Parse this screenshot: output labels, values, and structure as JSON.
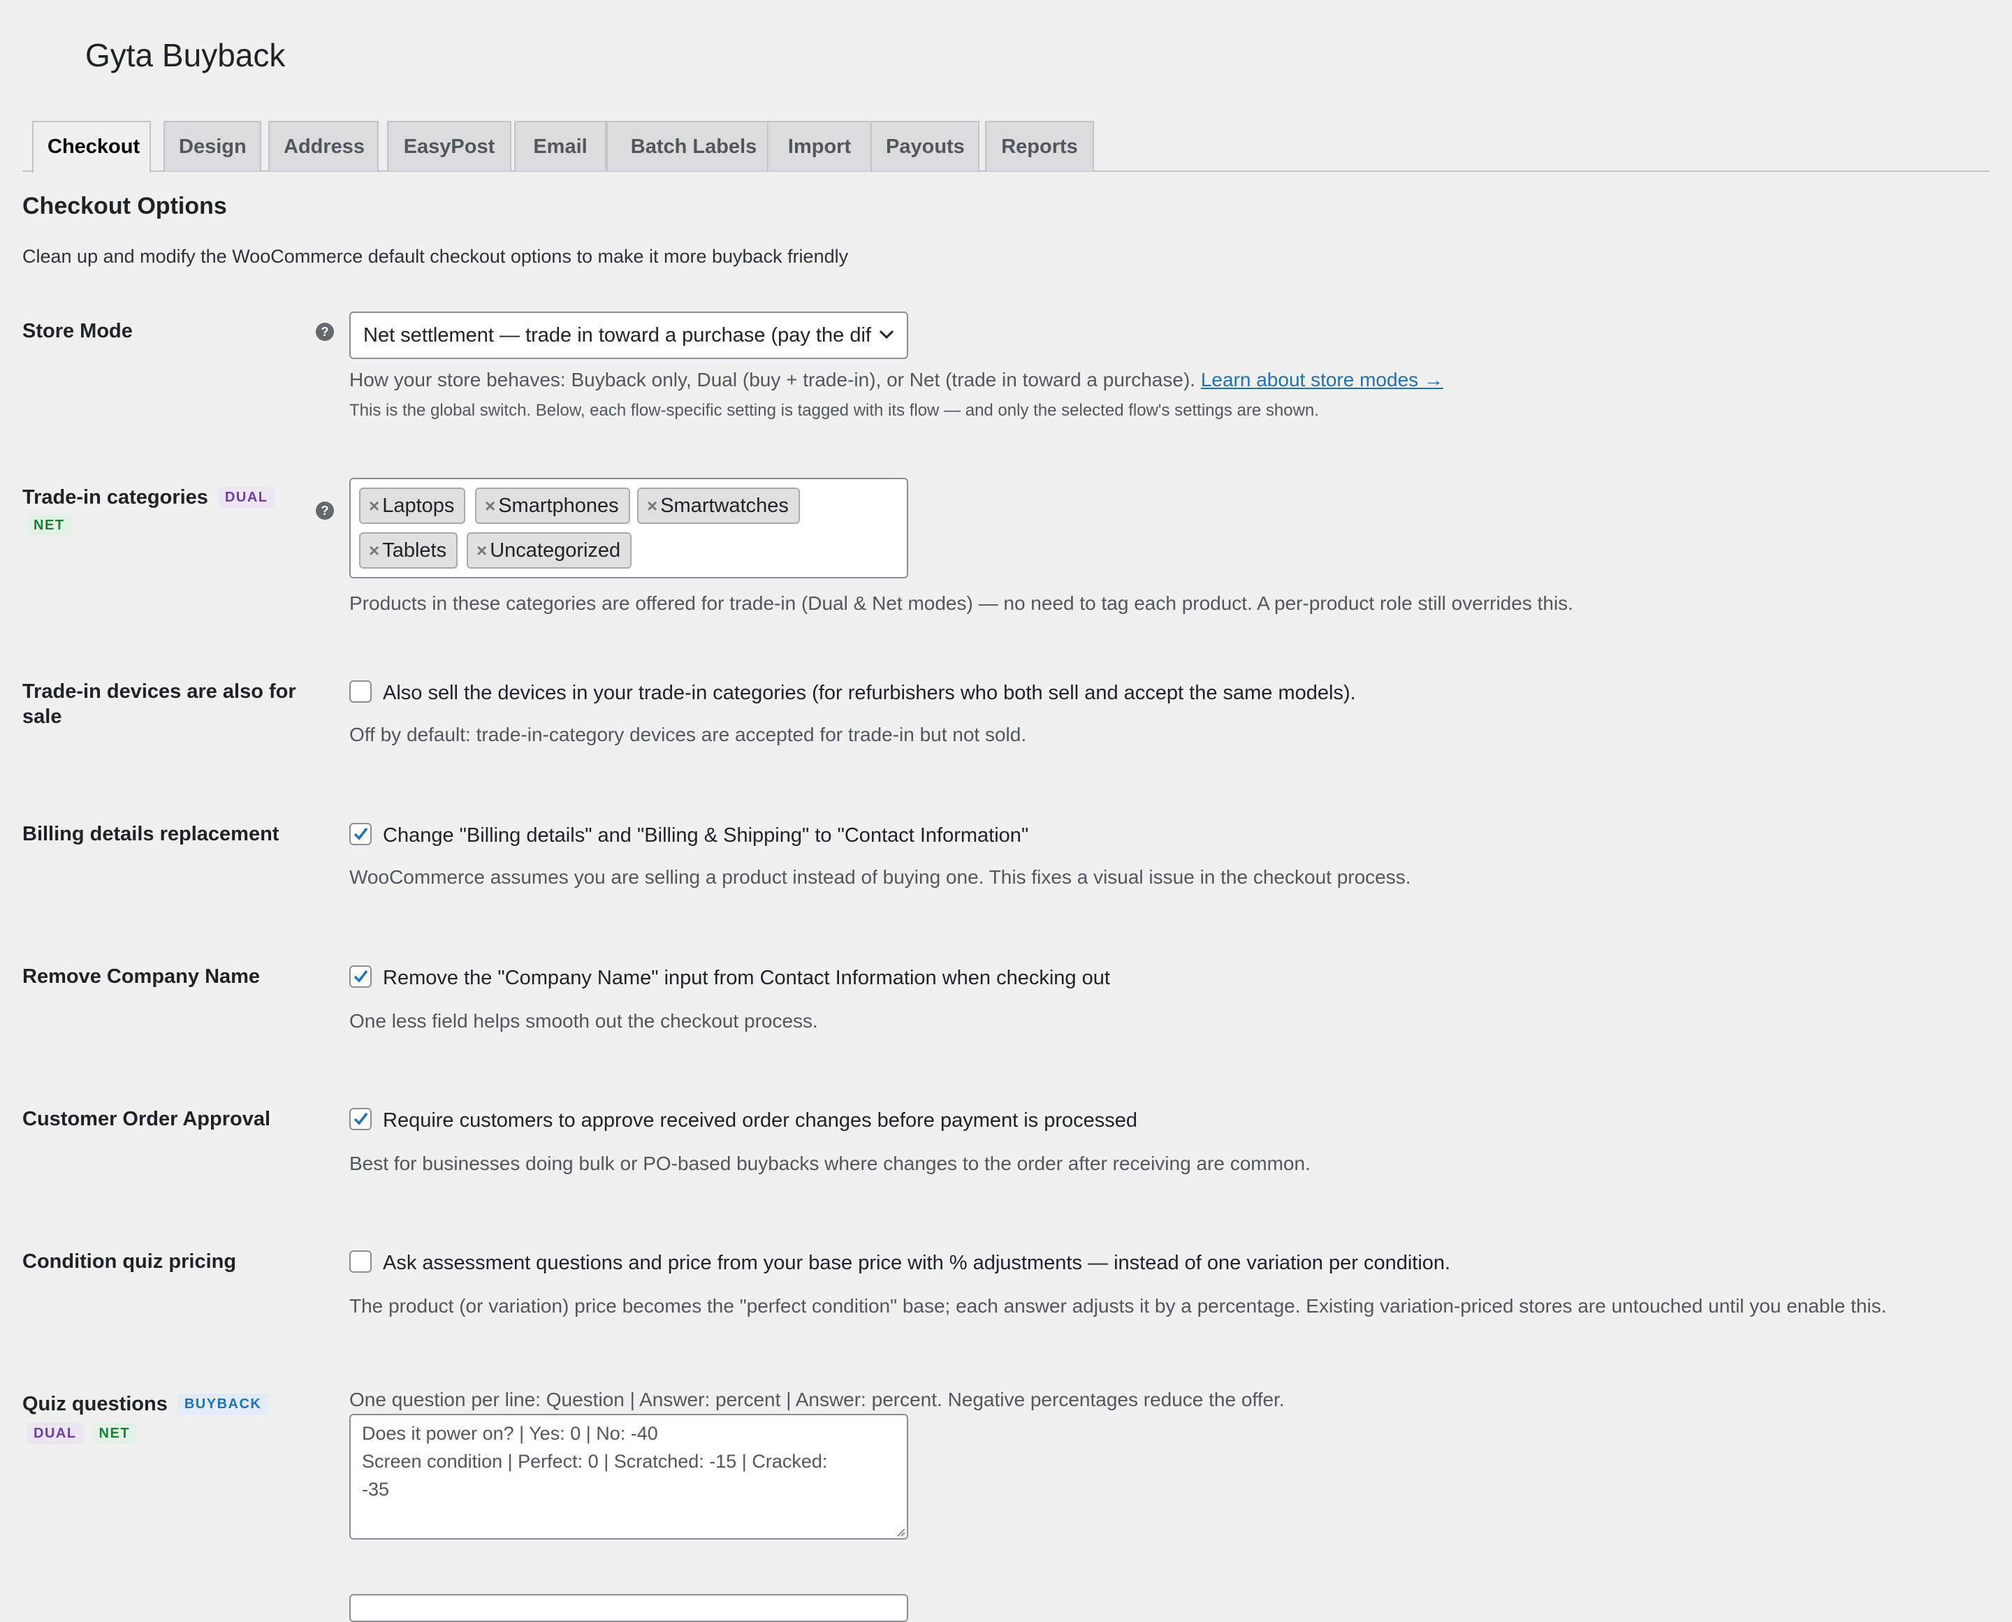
{
  "app": {
    "title": "Gyta Buyback"
  },
  "tabs": [
    {
      "label": "Checkout",
      "active": true
    },
    {
      "label": "Design"
    },
    {
      "label": "Address"
    },
    {
      "label": "EasyPost"
    },
    {
      "label": "Email"
    },
    {
      "label": "Batch Labels"
    },
    {
      "label": "Import"
    },
    {
      "label": "Payouts"
    },
    {
      "label": "Reports"
    }
  ],
  "section": {
    "title": "Checkout Options",
    "description": "Clean up and modify the WooCommerce default checkout options to make it more buyback friendly"
  },
  "badges": {
    "dual": "DUAL",
    "net": "NET",
    "buyback": "BUYBACK"
  },
  "store_mode": {
    "label": "Store Mode",
    "selected": "Net settlement — trade in toward a purchase (pay the dif",
    "description": "How your store behaves: Buyback only, Dual (buy + trade-in), or Net (trade in toward a purchase).",
    "link": "Learn about store modes →",
    "note": "This is the global switch. Below, each flow-specific setting is tagged with its flow — and only the selected flow's settings are shown."
  },
  "trade_in_categories": {
    "label": "Trade-in categories",
    "tags": [
      "Laptops",
      "Smartphones",
      "Smartwatches",
      "Tablets",
      "Uncategorized"
    ],
    "description": "Products in these categories are offered for trade-in (Dual & Net modes) — no need to tag each product. A per-product role still overrides this."
  },
  "trade_in_sale": {
    "label_line1": "Trade-in devices are also for",
    "label_line2": "sale",
    "checked": false,
    "checkbox_label": "Also sell the devices in your trade-in categories (for refurbishers who both sell and accept the same models).",
    "description": "Off by default: trade-in-category devices are accepted for trade-in but not sold."
  },
  "billing_replacement": {
    "label": "Billing details replacement",
    "checked": true,
    "checkbox_label": "Change \"Billing details\" and \"Billing & Shipping\" to \"Contact Information\"",
    "description": "WooCommerce assumes you are selling a product instead of buying one. This fixes a visual issue in the checkout process."
  },
  "remove_company": {
    "label": "Remove Company Name",
    "checked": true,
    "checkbox_label": "Remove the \"Company Name\" input from Contact Information when checking out",
    "description": "One less field helps smooth out the checkout process."
  },
  "order_approval": {
    "label": "Customer Order Approval",
    "checked": true,
    "checkbox_label": "Require customers to approve received order changes before payment is processed",
    "description": "Best for businesses doing bulk or PO-based buybacks where changes to the order after receiving are common."
  },
  "quiz_pricing": {
    "label": "Condition quiz pricing",
    "checked": false,
    "checkbox_label": "Ask assessment questions and price from your base price with % adjustments — instead of one variation per condition.",
    "description": "The product (or variation) price becomes the \"perfect condition\" base; each answer adjusts it by a percentage. Existing variation-priced stores are untouched until you enable this."
  },
  "quiz_questions": {
    "label": "Quiz questions",
    "help": "One question per line: Question | Answer: percent | Answer: percent. Negative percentages reduce the offer.",
    "lines": [
      "Does it power on? | Yes: 0 | No: -40",
      "Screen condition | Perfect: 0 | Scratched: -15 | Cracked:",
      "-35"
    ]
  },
  "colors": {
    "accent": "#2271b1",
    "background": "#f0f0f1"
  },
  "icons": {
    "help": "question-circle-icon",
    "check": "checkmark-icon",
    "remove": "x-icon",
    "chevron": "chevron-down-icon"
  }
}
